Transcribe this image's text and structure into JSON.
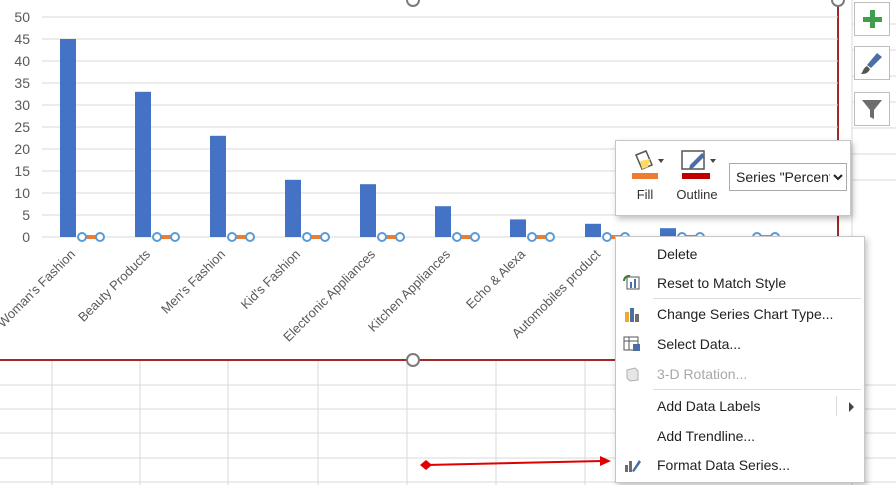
{
  "chart_data": {
    "type": "bar",
    "categories": [
      "Woman's Fashion",
      "Beauty Products",
      "Men's Fashion",
      "Kid's Fashion",
      "Electronic Appliances",
      "Kitchen Appliances",
      "Echo & Alexa",
      "Automobiles product",
      "",
      ""
    ],
    "series": [
      {
        "values": [
          45,
          33,
          23,
          13,
          12,
          7,
          4,
          3,
          2,
          0
        ],
        "color": "#4472c4"
      },
      {
        "values": [
          0,
          0,
          0,
          0,
          0,
          0,
          0,
          0,
          0,
          0
        ],
        "color": "#ed7d31"
      }
    ],
    "y_ticks": [
      0,
      5,
      10,
      15,
      20,
      25,
      30,
      35,
      40,
      45,
      50
    ],
    "ylim": [
      0,
      50
    ],
    "grid": true
  },
  "mini_toolbar": {
    "fill_label": "Fill",
    "outline_label": "Outline",
    "series_selector": "Series \"Percent",
    "fill_color": "#ed7d31",
    "outline_color": "#c00000"
  },
  "context_menu": {
    "items": [
      {
        "label": "Delete",
        "icon": "none",
        "enabled": true
      },
      {
        "label": "Reset to Match Style",
        "icon": "reset-style-icon",
        "enabled": true
      },
      {
        "label": "Change Series Chart Type...",
        "icon": "chart-type-icon",
        "enabled": true
      },
      {
        "label": "Select Data...",
        "icon": "select-data-icon",
        "enabled": true
      },
      {
        "label": "3-D Rotation...",
        "icon": "rotation-3d-icon",
        "enabled": false
      },
      {
        "label": "Add Data Labels",
        "icon": "none",
        "enabled": true,
        "submenu": true
      },
      {
        "label": "Add Trendline...",
        "icon": "none",
        "enabled": true
      },
      {
        "label": "Format Data Series...",
        "icon": "format-series-icon",
        "enabled": true
      }
    ]
  },
  "side_buttons": {
    "add_icon": "plus-icon",
    "style_icon": "brush-icon",
    "filter_icon": "filter-icon"
  },
  "colors": {
    "chart_border": "#a0282a",
    "arrow": "#e00000",
    "selected_point": "#5b9bd5"
  }
}
